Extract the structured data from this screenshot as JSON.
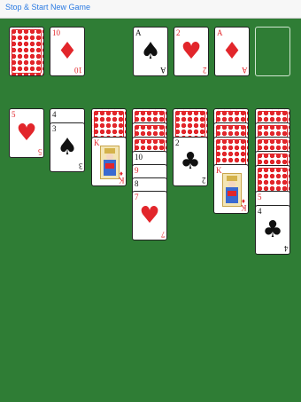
{
  "toolbar": {
    "new_game_label": "Stop & Start New Game"
  },
  "colors": {
    "felt": "#2f7d35",
    "red_suit": "#e2262b",
    "black_suit": "#111111",
    "link": "#2a7ae2"
  },
  "waste": {
    "rank": "10",
    "suit": "♦"
  },
  "foundations": [
    {
      "rank": "A",
      "suit": "♠"
    },
    {
      "rank": "2",
      "suit": "♥"
    },
    {
      "rank": "A",
      "suit": "♦"
    }
  ],
  "tableau": {
    "col1": {
      "rank": "5",
      "suit": "♥"
    },
    "col2": [
      {
        "rank": "4",
        "suit": "♠"
      },
      {
        "rank": "3",
        "suit": "♠"
      }
    ],
    "col3": {
      "rank": "K",
      "suit": "♦"
    },
    "col4": [
      {
        "rank": "10",
        "suit": "♠"
      },
      {
        "rank": "9",
        "suit": "♥"
      },
      {
        "rank": "8",
        "suit": "♠"
      },
      {
        "rank": "7",
        "suit": "♥"
      }
    ],
    "col5": {
      "rank": "2",
      "suit": "♣"
    },
    "col6": {
      "rank": "K",
      "suit": "♦"
    },
    "col7": [
      {
        "rank": "5",
        "suit": "♥"
      },
      {
        "rank": "4",
        "suit": "♣"
      }
    ]
  }
}
